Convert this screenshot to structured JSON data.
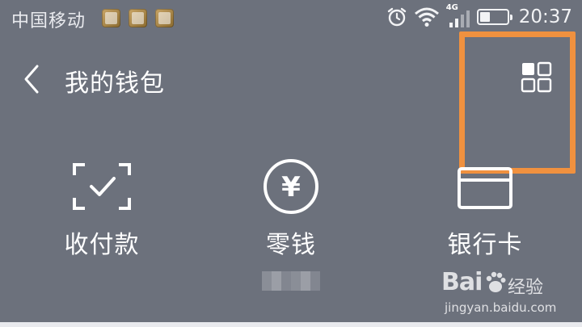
{
  "status_bar": {
    "carrier": "中国移动",
    "network_type": "4G",
    "time": "20:37",
    "battery_level": 0.45,
    "icons": [
      "app-icon-1",
      "app-icon-2",
      "gallery-icon",
      "alarm-icon",
      "wifi-icon",
      "signal-icon",
      "battery-icon"
    ]
  },
  "header": {
    "title": "我的钱包",
    "back_icon": "chevron-left-icon",
    "menu_icon": "grid-icon"
  },
  "features": [
    {
      "label": "收付款",
      "icon": "scan-check-icon"
    },
    {
      "label": "零钱",
      "icon": "yen-circle-icon"
    },
    {
      "label": "银行卡",
      "icon": "card-icon"
    }
  ],
  "watermark": {
    "brand": "Bai",
    "brand_end": "经验",
    "url": "jingyan.baidu.com"
  },
  "colors": {
    "background": "#6c717c",
    "highlight": "#f0913f",
    "foreground": "#ffffff"
  }
}
